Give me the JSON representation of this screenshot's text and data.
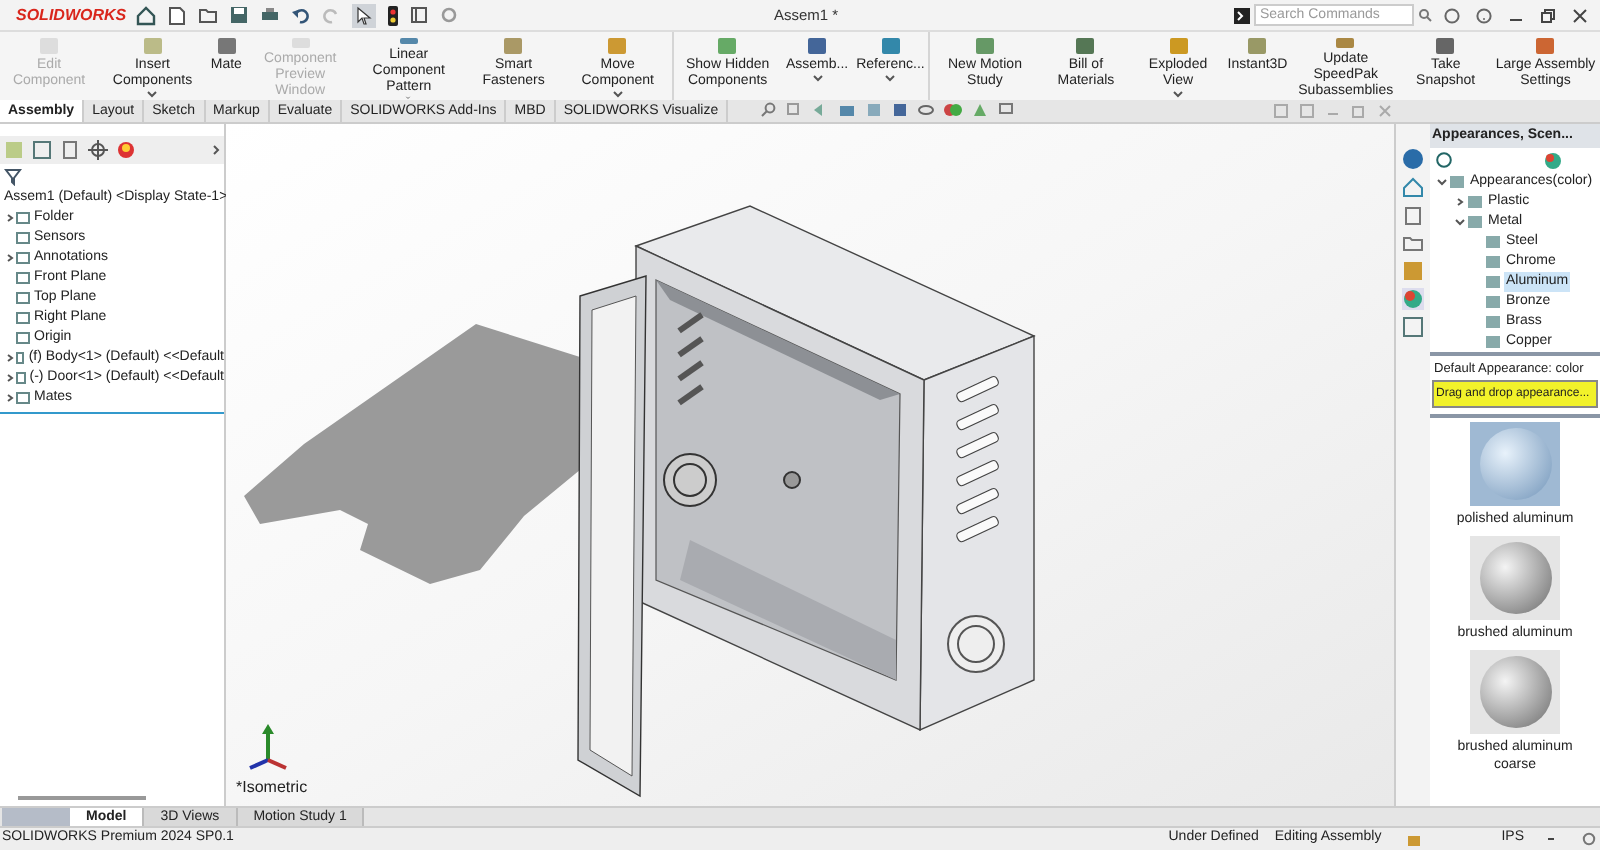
{
  "app_bar": {
    "logo": "SOLIDWORKS",
    "title": "Assem1 *",
    "search": {
      "placeholder": "Search Commands"
    }
  },
  "ribbon": [
    {
      "label": "Edit Component",
      "disabled": true,
      "dropdown": false
    },
    {
      "label": "Insert Components",
      "disabled": false,
      "dropdown": true
    },
    {
      "label": "Mate",
      "disabled": false,
      "dropdown": false
    },
    {
      "label": "Component Preview Window",
      "disabled": true,
      "dropdown": false
    },
    {
      "label": "Linear Component Pattern",
      "disabled": false,
      "dropdown": true
    },
    {
      "label": "Smart Fasteners",
      "disabled": false,
      "dropdown": false
    },
    {
      "label": "Move Component",
      "disabled": false,
      "dropdown": true
    },
    {
      "label": "Show Hidden Components",
      "disabled": false,
      "dropdown": false
    },
    {
      "label": "Assemb...",
      "disabled": false,
      "dropdown": true
    },
    {
      "label": "Referenc...",
      "disabled": false,
      "dropdown": true
    },
    {
      "label": "New Motion Study",
      "disabled": false,
      "dropdown": false
    },
    {
      "label": "Bill of Materials",
      "disabled": false,
      "dropdown": false
    },
    {
      "label": "Exploded View",
      "disabled": false,
      "dropdown": true
    },
    {
      "label": "Instant3D",
      "disabled": false,
      "dropdown": false
    },
    {
      "label": "Update SpeedPak Subassemblies",
      "disabled": false,
      "dropdown": false
    },
    {
      "label": "Take Snapshot",
      "disabled": false,
      "dropdown": false
    },
    {
      "label": "Large Assembly Settings",
      "disabled": false,
      "dropdown": false
    }
  ],
  "tabs": [
    {
      "label": "Assembly",
      "selected": true
    },
    {
      "label": "Layout",
      "selected": false
    },
    {
      "label": "Sketch",
      "selected": false
    },
    {
      "label": "Markup",
      "selected": false
    },
    {
      "label": "Evaluate",
      "selected": false
    },
    {
      "label": "SOLIDWORKS Add-Ins",
      "selected": false
    },
    {
      "label": "MBD",
      "selected": false
    },
    {
      "label": "SOLIDWORKS Visualize",
      "selected": false
    }
  ],
  "feature_tree": {
    "root": "Assem1 (Default) <Display State-1>",
    "items": [
      {
        "label": "Folder",
        "expandable": true
      },
      {
        "label": "Sensors",
        "expandable": false
      },
      {
        "label": "Annotations",
        "expandable": true
      },
      {
        "label": "Front Plane",
        "expandable": false
      },
      {
        "label": "Top Plane",
        "expandable": false
      },
      {
        "label": "Right Plane",
        "expandable": false
      },
      {
        "label": "Origin",
        "expandable": false
      },
      {
        "label": "(f) Body<1> (Default) <<Default",
        "expandable": true
      },
      {
        "label": "(-) Door<1> (Default) <<Default",
        "expandable": true
      },
      {
        "label": "Mates",
        "expandable": true
      }
    ]
  },
  "viewport": {
    "view_label": "*Isometric"
  },
  "task_pane": {
    "title": "Appearances, Scen...",
    "tree": [
      {
        "label": "Appearances(color)",
        "expanded": true,
        "selected": false,
        "children": [
          {
            "label": "Plastic",
            "expanded": false,
            "selected": false
          },
          {
            "label": "Metal",
            "expanded": true,
            "selected": false,
            "children": [
              {
                "label": "Steel",
                "selected": false
              },
              {
                "label": "Chrome",
                "selected": false
              },
              {
                "label": "Aluminum",
                "selected": true
              },
              {
                "label": "Bronze",
                "selected": false
              },
              {
                "label": "Brass",
                "selected": false
              },
              {
                "label": "Copper",
                "selected": false
              }
            ]
          }
        ]
      }
    ],
    "default_appearance": "Default Appearance: color",
    "hint": "Drag and drop appearance...",
    "swatches": [
      {
        "label": "polished aluminum",
        "selected": true
      },
      {
        "label": "brushed aluminum",
        "selected": false
      },
      {
        "label": "brushed aluminum coarse",
        "selected": false
      }
    ]
  },
  "bottom_tabs": [
    {
      "label": "Model",
      "selected": true
    },
    {
      "label": "3D Views",
      "selected": false
    },
    {
      "label": "Motion Study 1",
      "selected": false
    }
  ],
  "status_bar": {
    "product": "SOLIDWORKS Premium 2024 SP0.1",
    "state": "Under Defined",
    "mode": "Editing Assembly",
    "units": "IPS"
  }
}
